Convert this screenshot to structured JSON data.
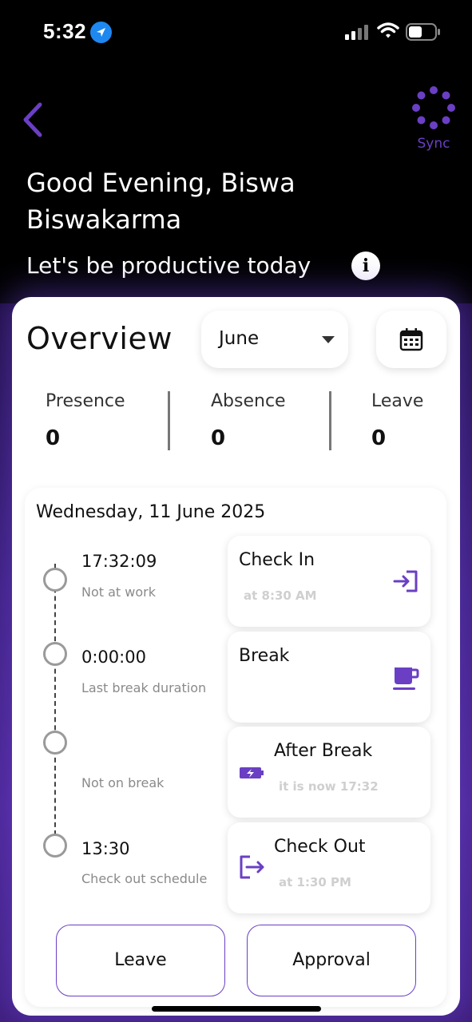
{
  "status_bar": {
    "time": "5:32"
  },
  "header": {
    "sync_label": "Sync",
    "greeting": "Good Evening, Biswa Biswakarma",
    "tagline": "Let's be productive today",
    "info_glyph": "i"
  },
  "overview": {
    "title": "Overview",
    "month": "June",
    "stats": [
      {
        "label": "Presence",
        "value": "0"
      },
      {
        "label": "Absence",
        "value": "0"
      },
      {
        "label": "Leave",
        "value": "0"
      }
    ]
  },
  "day": {
    "date_title": "Wednesday, 11 June 2025",
    "timeline": [
      {
        "value": "17:32:09",
        "sub": "Not at work"
      },
      {
        "value": "0:00:00",
        "sub": "Last break duration"
      },
      {
        "value": "",
        "sub": "Not on break"
      },
      {
        "value": "13:30",
        "sub": "Check out schedule"
      }
    ],
    "actions": [
      {
        "title": "Check In",
        "sub": "at 8:30 AM",
        "icon": "login-icon"
      },
      {
        "title": "Break",
        "sub": "",
        "icon": "coffee-cup-icon"
      },
      {
        "title": "After Break",
        "sub": "it is now 17:32",
        "icon": "battery-charging-icon"
      },
      {
        "title": "Check Out",
        "sub": "at 1:30 PM",
        "icon": "logout-icon"
      }
    ]
  },
  "buttons": {
    "leave": "Leave",
    "approval": "Approval"
  },
  "colors": {
    "accent": "#6a3fc4",
    "background": "#000000",
    "card": "#ffffff"
  }
}
